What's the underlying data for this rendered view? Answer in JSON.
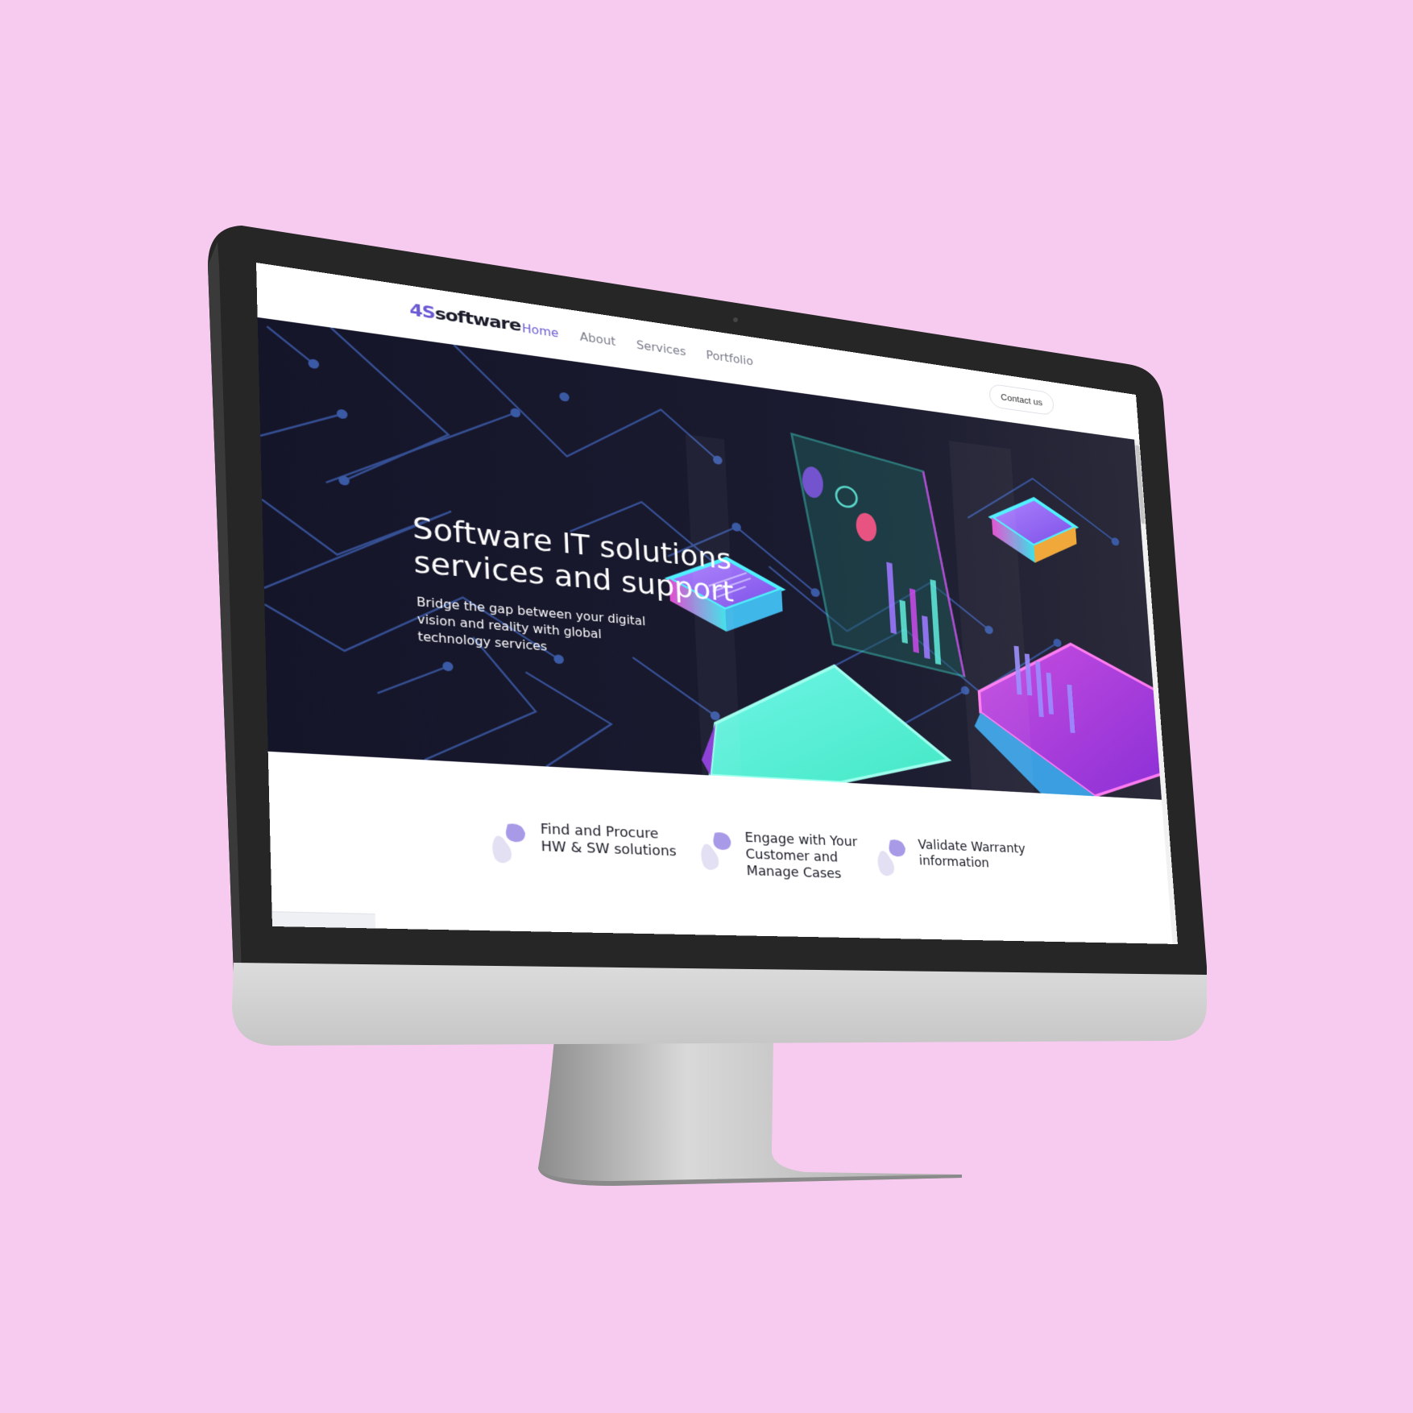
{
  "brand": {
    "logo_mark": "4S",
    "logo_text": "software",
    "accent_color": "#6c5bd4",
    "background_color": "#f7cbef"
  },
  "nav": {
    "items": [
      {
        "label": "Home",
        "active": true
      },
      {
        "label": "About",
        "active": false
      },
      {
        "label": "Services",
        "active": false
      },
      {
        "label": "Portfolio",
        "active": false
      }
    ],
    "contact_label": "Contact us"
  },
  "hero": {
    "title": "Software IT solutions services and support",
    "subtitle": "Bridge the gap between your digital vision and reality with global technology services"
  },
  "features": [
    {
      "label": "Find and Procure HW & SW solutions",
      "icon": "blob-icon"
    },
    {
      "label": "Engage with Your Customer and Manage Cases",
      "icon": "blob-icon"
    },
    {
      "label": "Validate Warranty information",
      "icon": "blob-icon"
    }
  ]
}
